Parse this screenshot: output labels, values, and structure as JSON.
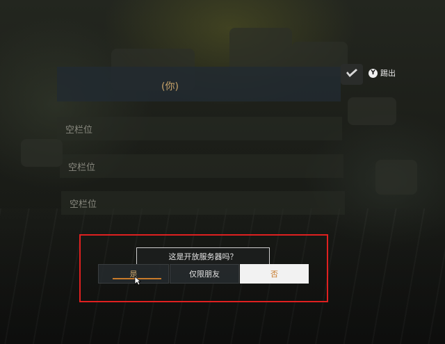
{
  "party": {
    "player_name": "(你)",
    "kick_button": "Y",
    "kick_label": "踢出",
    "empty_slots": [
      "空栏位",
      "空栏位",
      "空栏位"
    ]
  },
  "dialog": {
    "question": "这是开放服务器吗？",
    "yes_label": "是",
    "friends_only_label": "仅限朋友",
    "no_label": "否"
  }
}
